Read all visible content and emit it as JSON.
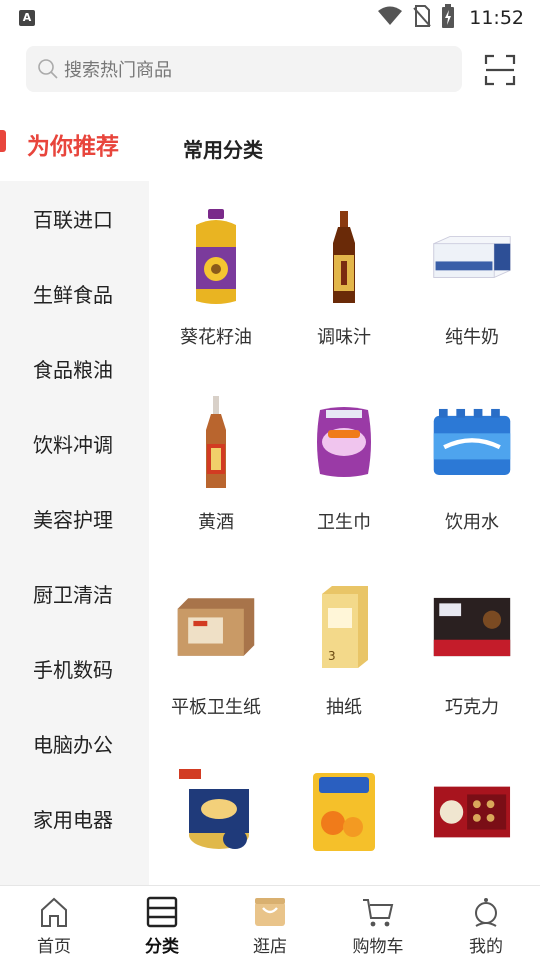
{
  "status_bar": {
    "app_icon_letter": "A",
    "time": "11:52",
    "icons": [
      "wifi-icon",
      "no-sim-icon",
      "battery-charging-icon"
    ]
  },
  "search": {
    "placeholder": "搜索热门商品",
    "scan_icon": "scan-icon"
  },
  "sidebar": {
    "items": [
      {
        "label": "为你推荐",
        "active": true
      },
      {
        "label": "百联进口"
      },
      {
        "label": "生鲜食品"
      },
      {
        "label": "食品粮油"
      },
      {
        "label": "饮料冲调"
      },
      {
        "label": "美容护理"
      },
      {
        "label": "厨卫清洁"
      },
      {
        "label": "手机数码"
      },
      {
        "label": "电脑办公"
      },
      {
        "label": "家用电器"
      }
    ]
  },
  "main": {
    "section_title": "常用分类",
    "products": [
      {
        "name": "葵花籽油",
        "image": "sunflower-oil-image"
      },
      {
        "name": "调味汁",
        "image": "seasoning-sauce-image"
      },
      {
        "name": "纯牛奶",
        "image": "milk-box-image"
      },
      {
        "name": "黄酒",
        "image": "yellow-wine-image"
      },
      {
        "name": "卫生巾",
        "image": "sanitary-pad-image"
      },
      {
        "name": "饮用水",
        "image": "bottled-water-image"
      },
      {
        "name": "平板卫生纸",
        "image": "flat-tissue-image"
      },
      {
        "name": "抽纸",
        "image": "tissue-box-image"
      },
      {
        "name": "巧克力",
        "image": "chocolate-image"
      },
      {
        "name": "",
        "image": "butter-cookies-image"
      },
      {
        "name": "",
        "image": "wet-wipes-image"
      },
      {
        "name": "",
        "image": "gift-cookies-image"
      }
    ]
  },
  "tab_bar": {
    "tabs": [
      {
        "label": "首页",
        "icon": "home-icon"
      },
      {
        "label": "分类",
        "icon": "category-icon",
        "active": true
      },
      {
        "label": "逛店",
        "icon": "shopping-bag-icon"
      },
      {
        "label": "购物车",
        "icon": "cart-icon"
      },
      {
        "label": "我的",
        "icon": "profile-icon"
      }
    ]
  },
  "colors": {
    "accent": "#e8453c",
    "sidebar_bg": "#f5f5f5",
    "search_bg": "#f3f3f3"
  }
}
